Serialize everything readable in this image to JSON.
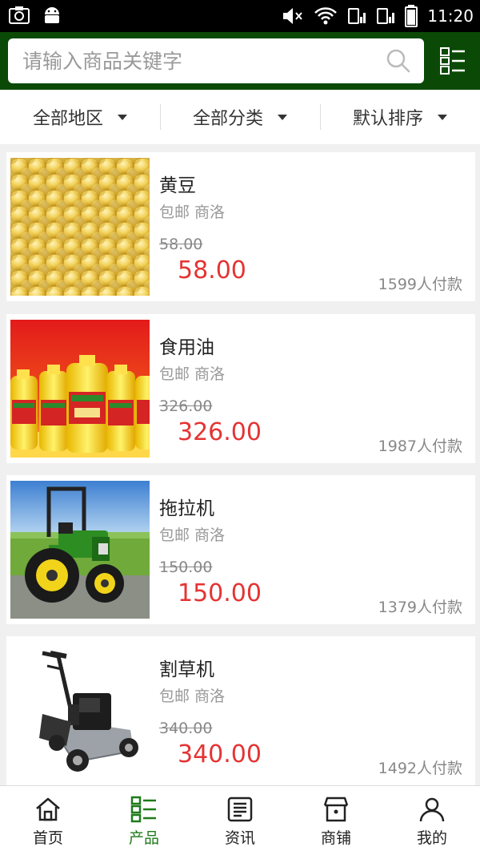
{
  "status_bar": {
    "time": "11:20"
  },
  "search": {
    "placeholder": "请输入商品关键字"
  },
  "filters": [
    "全部地区",
    "全部分类",
    "默认排序"
  ],
  "products": [
    {
      "name": "黄豆",
      "tags": "包邮 商洛",
      "old_price": "58.00",
      "price": "58.00",
      "sold": "1599人付款"
    },
    {
      "name": "食用油",
      "tags": "包邮 商洛",
      "old_price": "326.00",
      "price": "326.00",
      "sold": "1987人付款"
    },
    {
      "name": "拖拉机",
      "tags": "包邮 商洛",
      "old_price": "150.00",
      "price": "150.00",
      "sold": "1379人付款"
    },
    {
      "name": "割草机",
      "tags": "包邮 商洛",
      "old_price": "340.00",
      "price": "340.00",
      "sold": "1492人付款"
    }
  ],
  "tabs": [
    {
      "label": "首页",
      "icon": "home-icon"
    },
    {
      "label": "产品",
      "icon": "grid-list-icon"
    },
    {
      "label": "资讯",
      "icon": "news-icon"
    },
    {
      "label": "商铺",
      "icon": "shop-icon"
    },
    {
      "label": "我的",
      "icon": "user-icon"
    }
  ],
  "colors": {
    "header": "#0b4a06",
    "price": "#e53333",
    "active_tab": "#1e7b1a"
  }
}
